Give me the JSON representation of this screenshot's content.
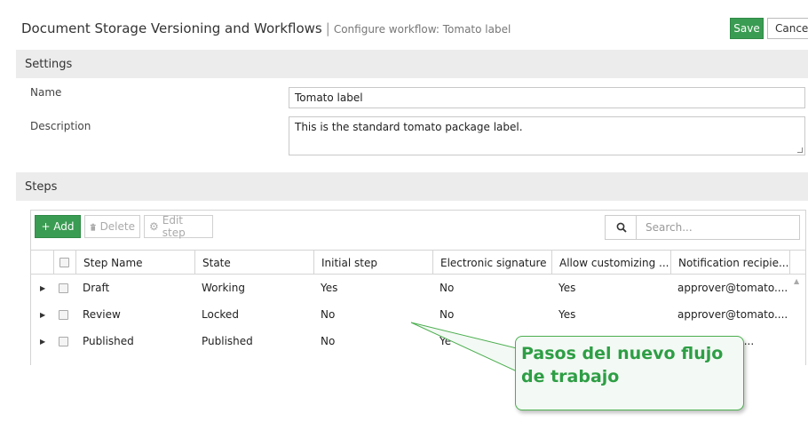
{
  "header": {
    "title": "Document Storage Versioning and Workflows",
    "separator": "|",
    "subtitle": "Configure workflow: Tomato label",
    "save_label": "Save",
    "cancel_label": "Cancel"
  },
  "settings": {
    "section_title": "Settings",
    "name_label": "Name",
    "name_value": "Tomato label",
    "description_label": "Description",
    "description_value": "This is the standard tomato package label."
  },
  "steps": {
    "section_title": "Steps",
    "toolbar": {
      "add_label": "+ Add",
      "delete_label": "Delete",
      "edit_label": "Edit step",
      "search_placeholder": "Search..."
    },
    "columns": [
      "Step Name",
      "State",
      "Initial step",
      "Electronic signature",
      "Allow customizing ...",
      "Notification recipie..."
    ],
    "rows": [
      {
        "name": "Draft",
        "state": "Working",
        "initial": "Yes",
        "esig": "No",
        "customizing": "Yes",
        "notification": "approver@tomato...."
      },
      {
        "name": "Review",
        "state": "Locked",
        "initial": "No",
        "esig": "No",
        "customizing": "Yes",
        "notification": "approver@tomato...."
      },
      {
        "name": "Published",
        "state": "Published",
        "initial": "No",
        "esig": "Ye",
        "customizing": "",
        "notification": "mato...."
      }
    ]
  },
  "callout": {
    "line1": "Pasos del nuevo flujo",
    "line2": "de trabajo"
  },
  "colors": {
    "accent_green": "#3a9c52",
    "callout_text": "#2e9e45"
  }
}
